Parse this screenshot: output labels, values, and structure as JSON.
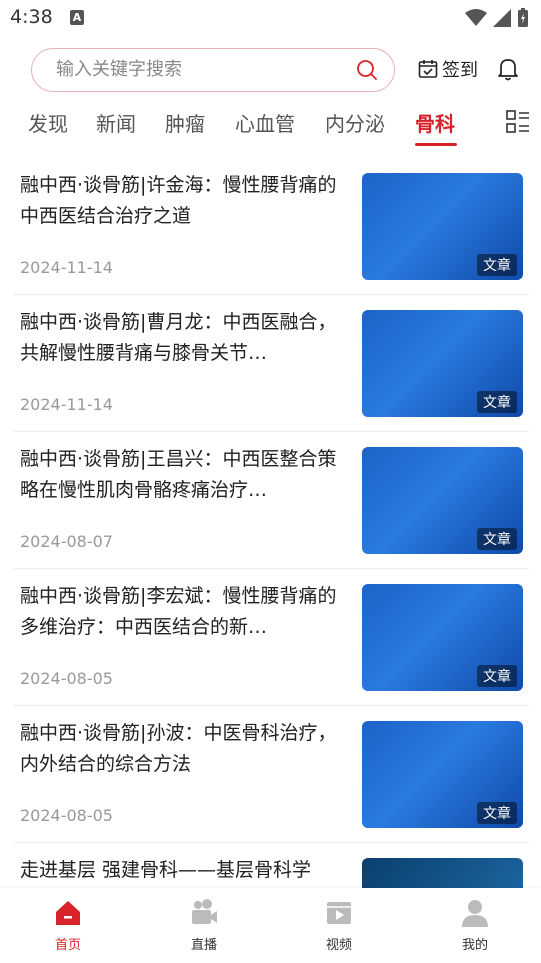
{
  "status_bar": {
    "time": "4:38",
    "notif_icon_letter": "A"
  },
  "search": {
    "placeholder": "输入关键字搜索"
  },
  "header": {
    "checkin_label": "签到"
  },
  "tabs": [
    {
      "label": "发现"
    },
    {
      "label": "新闻"
    },
    {
      "label": "肿瘤"
    },
    {
      "label": "心血管"
    },
    {
      "label": "内分泌"
    },
    {
      "label": "骨科",
      "active": true
    }
  ],
  "articles": [
    {
      "title": "融中西·谈骨筋|许金海：慢性腰背痛的中西医结合治疗之道",
      "date": "2024-11-14",
      "badge": "文章"
    },
    {
      "title": "融中西·谈骨筋|曹月龙：中西医融合，共解慢性腰背痛与膝骨关节…",
      "date": "2024-11-14",
      "badge": "文章"
    },
    {
      "title": "融中西·谈骨筋|王昌兴：中西医整合策略在慢性肌肉骨骼疼痛治疗…",
      "date": "2024-08-07",
      "badge": "文章"
    },
    {
      "title": "融中西·谈骨筋|李宏斌：慢性腰背痛的多维治疗：中西医结合的新…",
      "date": "2024-08-05",
      "badge": "文章"
    },
    {
      "title": "融中西·谈骨筋|孙波：中医骨科治疗，内外结合的综合方法",
      "date": "2024-08-05",
      "badge": "文章"
    },
    {
      "title": "走进基层 强建骨科——基层骨科学",
      "date": "",
      "badge": ""
    }
  ],
  "bottom_nav": [
    {
      "label": "首页",
      "active": true,
      "icon": "home-icon"
    },
    {
      "label": "直播",
      "icon": "live-icon"
    },
    {
      "label": "视频",
      "icon": "video-icon"
    },
    {
      "label": "我的",
      "icon": "profile-icon"
    }
  ],
  "colors": {
    "accent": "#d9232a",
    "thumb_blue": "#1c63c7"
  }
}
